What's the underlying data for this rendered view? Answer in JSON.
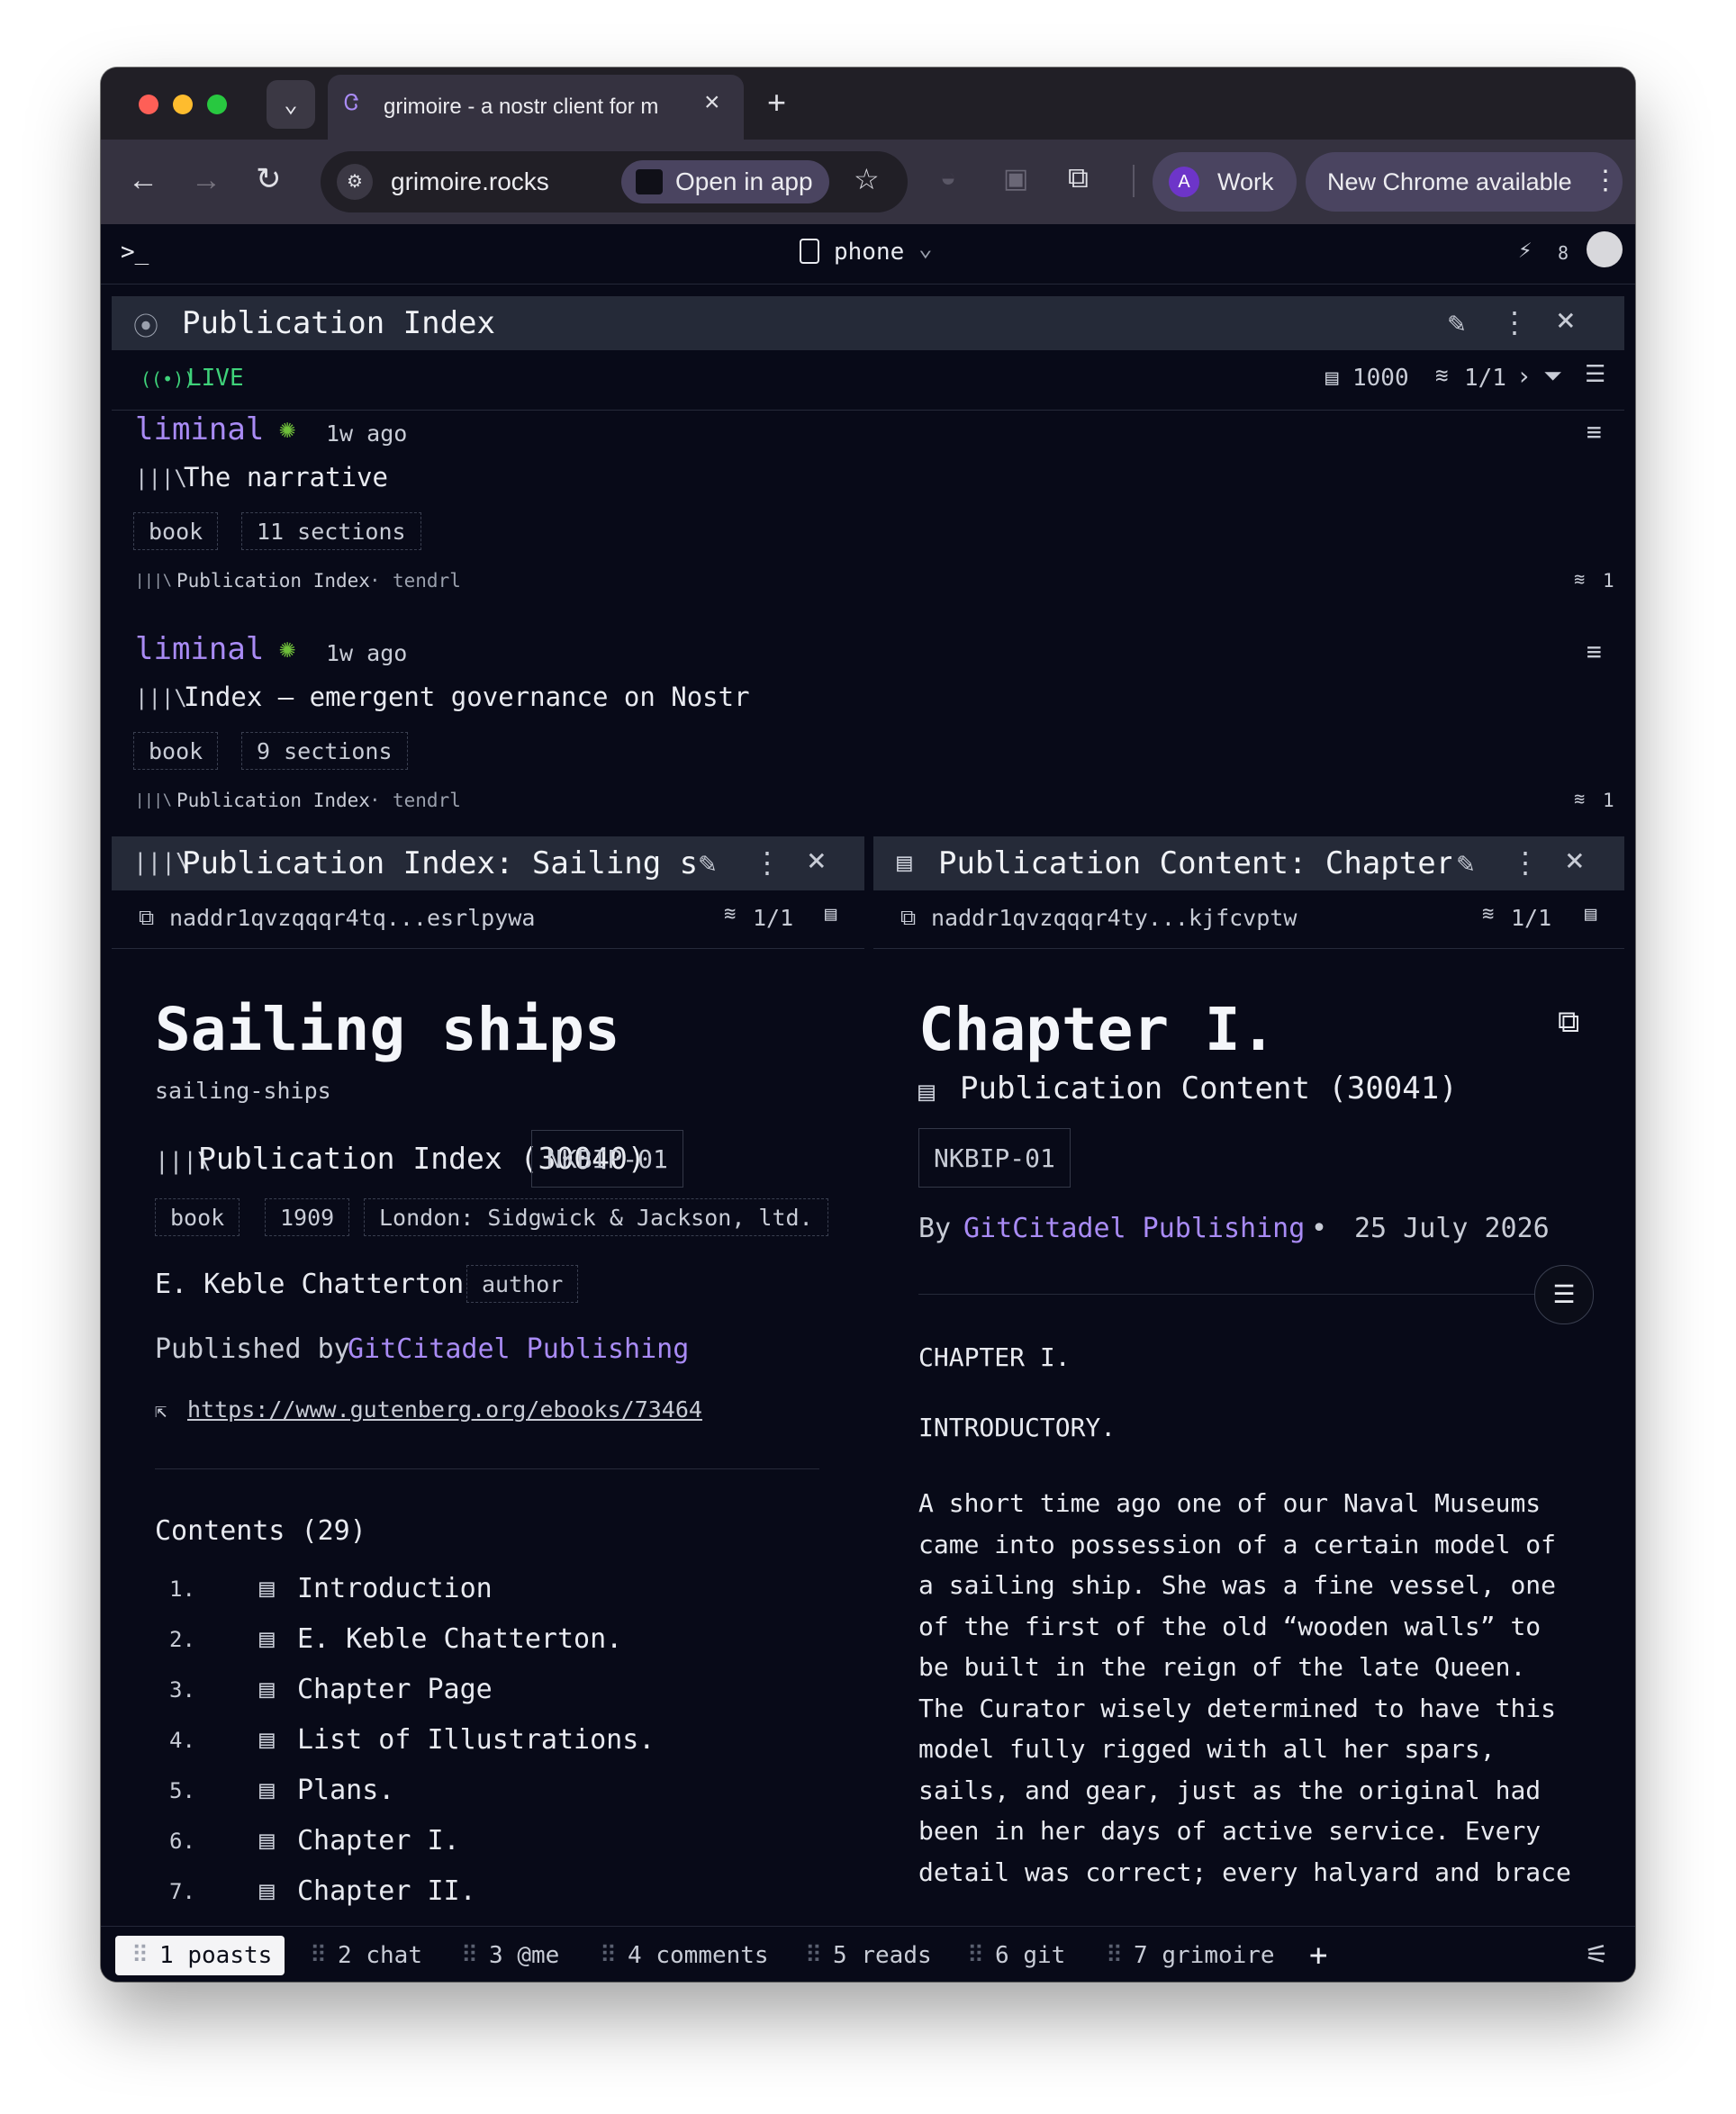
{
  "browser": {
    "tab_title": "grimoire - a nostr client for m",
    "url": "grimoire.rocks",
    "open_in_app": "Open in app",
    "profile_initial": "A",
    "profile_name": "Work",
    "update_label": "New Chrome available"
  },
  "appbar": {
    "prompt": ">_",
    "layout_label": "phone",
    "wand_count": "8"
  },
  "top_panel": {
    "title": "Publication Index",
    "live": "LIVE",
    "event_count": "1000",
    "relays": "1/1",
    "items": [
      {
        "author": "liminal",
        "time": "1w ago",
        "title": "The narrative",
        "tags": [
          "book",
          "11 sections"
        ],
        "kind": "Publication Index",
        "client": "tendrl",
        "relays": "1"
      },
      {
        "author": "liminal",
        "time": "1w ago",
        "title": "Index — emergent governance on Nostr",
        "tags": [
          "book",
          "9 sections"
        ],
        "kind": "Publication Index",
        "client": "tendrl",
        "relays": "1"
      }
    ]
  },
  "left_panel": {
    "title": "Publication Index: Sailing sh",
    "naddr": "naddr1qvzqqqr4tq...esrlpywa",
    "relays": "1/1",
    "heading": "Sailing ships",
    "slug": "sailing-ships",
    "kind_label": "Publication Index (30040)",
    "nip": "NKBIP-01",
    "tags": [
      "book",
      "1909",
      "London: Sidgwick & Jackson, ltd."
    ],
    "author_name": "E. Keble Chatterton",
    "author_role": "author",
    "published_prefix": "Published by",
    "publisher": "GitCitadel Publishing",
    "link": "https://www.gutenberg.org/ebooks/73464",
    "contents_title": "Contents (29)",
    "contents": [
      {
        "num": "1.",
        "label": "Introduction"
      },
      {
        "num": "2.",
        "label": "E. Keble Chatterton."
      },
      {
        "num": "3.",
        "label": "Chapter Page"
      },
      {
        "num": "4.",
        "label": "List of Illustrations."
      },
      {
        "num": "5.",
        "label": "Plans."
      },
      {
        "num": "6.",
        "label": "Chapter I."
      },
      {
        "num": "7.",
        "label": "Chapter II."
      }
    ]
  },
  "right_panel": {
    "title": "Publication Content: Chapter",
    "naddr": "naddr1qvzqqqr4ty...kjfcvptw",
    "relays": "1/1",
    "heading": "Chapter I.",
    "kind_label": "Publication Content (30041)",
    "nip": "NKBIP-01",
    "by_prefix": "By",
    "publisher": "GitCitadel Publishing",
    "bullet": "•",
    "date": "25 July 2026",
    "para1": "CHAPTER I.",
    "para2": "INTRODUCTORY.",
    "body_lines": [
      "A short time ago one of our Naval Museums",
      "came into possession of a certain model of",
      "a sailing ship. She was a fine vessel, one",
      "of the first of the old “wooden walls” to",
      "be built in the reign of the late Queen.",
      "The Curator wisely determined to have this",
      "model fully rigged with all her spars,",
      "sails, and gear, just as the original had",
      "been in her days of active service. Every",
      "detail was correct; every halyard and brace"
    ]
  },
  "bottom_tabs": [
    {
      "label": "1 poasts",
      "active": true
    },
    {
      "label": "2 chat",
      "active": false
    },
    {
      "label": "3 @me",
      "active": false
    },
    {
      "label": "4 comments",
      "active": false
    },
    {
      "label": "5 reads",
      "active": false
    },
    {
      "label": "6 git",
      "active": false
    },
    {
      "label": "7 grimoire",
      "active": false
    }
  ],
  "colors": {
    "accent": "#a98bf5",
    "live": "#3fd27a",
    "background": "#080a18",
    "panel_header": "#252a38"
  }
}
